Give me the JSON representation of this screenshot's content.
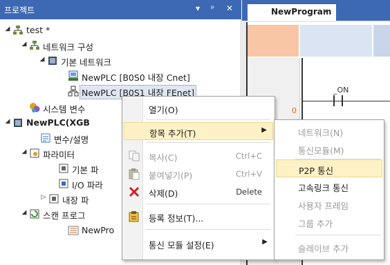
{
  "panel": {
    "title": "프로젝트",
    "header_buttons": [
      "▾",
      "ᵖ",
      "✕"
    ]
  },
  "tree": [
    {
      "label": "test *",
      "expander": "◢",
      "icon": "network-project-icon",
      "depth": 0
    },
    {
      "label": "네트워크 구성",
      "expander": "◢",
      "icon": "network-config-icon",
      "depth": 1
    },
    {
      "label": "기본 네트워크",
      "expander": "◢",
      "icon": "basic-network-icon",
      "depth": 2
    },
    {
      "label": "NewPLC [B0S0 내장 Cnet]",
      "expander": "",
      "icon": "cnet-module-icon",
      "depth": 3
    },
    {
      "label": "NewPLC [B0S1 내장 FEnet]",
      "expander": "",
      "icon": "fenet-module-icon",
      "depth": 3
    },
    {
      "label": "시스템 변수",
      "expander": "",
      "icon": "system-variable-icon",
      "depth": 1
    },
    {
      "label": "NewPLC(XGB",
      "expander": "◢",
      "icon": "plc-icon",
      "depth": 0
    },
    {
      "label": "변수/설명",
      "expander": "",
      "icon": "variable-comment-icon",
      "depth": 1
    },
    {
      "label": "파라미터",
      "expander": "◢",
      "icon": "parameter-icon",
      "depth": 1
    },
    {
      "label": "기본 파",
      "expander": "",
      "icon": "basic-parameter-icon",
      "depth": 2
    },
    {
      "label": "I/O 파라",
      "expander": "",
      "icon": "io-parameter-icon",
      "depth": 2
    },
    {
      "label": "내장 파",
      "expander": "▷",
      "icon": "builtin-parameter-icon",
      "depth": 2
    },
    {
      "label": "스캔 프로그",
      "expander": "◢",
      "icon": "scan-program-icon",
      "depth": 1
    },
    {
      "label": "NewPro",
      "expander": "",
      "icon": "program-icon",
      "depth": 2
    }
  ],
  "editor": {
    "tab_label": "NewProgram",
    "tab_close": "✕",
    "rung_number": "0",
    "contact_label": "_ON"
  },
  "context_menu": {
    "items": [
      {
        "label": "열기(O)",
        "shortcut": "",
        "submenu": false,
        "disabled": false,
        "icon": ""
      },
      {
        "label": "항목 추가(T)",
        "shortcut": "",
        "submenu": true,
        "disabled": false,
        "icon": "",
        "highlighted": true
      },
      {
        "label": "복사(C)",
        "shortcut": "Ctrl+C",
        "submenu": false,
        "disabled": true,
        "icon": "copy-icon"
      },
      {
        "label": "붙여넣기(P)",
        "shortcut": "Ctrl+V",
        "submenu": false,
        "disabled": true,
        "icon": "paste-icon"
      },
      {
        "label": "삭제(D)",
        "shortcut": "Delete",
        "submenu": false,
        "disabled": false,
        "icon": "delete-icon"
      },
      {
        "label": "등록 정보(T)...",
        "shortcut": "",
        "submenu": false,
        "disabled": false,
        "icon": "properties-icon"
      },
      {
        "label": "통신 모듈 설정(E)",
        "shortcut": "",
        "submenu": true,
        "disabled": false,
        "icon": ""
      }
    ],
    "submenu_arrow": "▶"
  },
  "submenu": {
    "items": [
      {
        "label": "네트워크(N)",
        "disabled": true
      },
      {
        "label": "통신모듈(M)",
        "disabled": true
      },
      {
        "label": "P2P 통신",
        "disabled": false,
        "highlighted": true
      },
      {
        "label": "고속링크 통신",
        "disabled": false
      },
      {
        "label": "사용자 프레임",
        "disabled": true
      },
      {
        "label": "그룹 추가",
        "disabled": true
      },
      {
        "label": "슬레이브 추가",
        "disabled": true
      }
    ]
  },
  "colors": {
    "header_blue": "#3c68b4",
    "menu_highlight": "#fdf1c5",
    "disabled_text": "#9b9b9b",
    "rung_number": "#e07000"
  }
}
